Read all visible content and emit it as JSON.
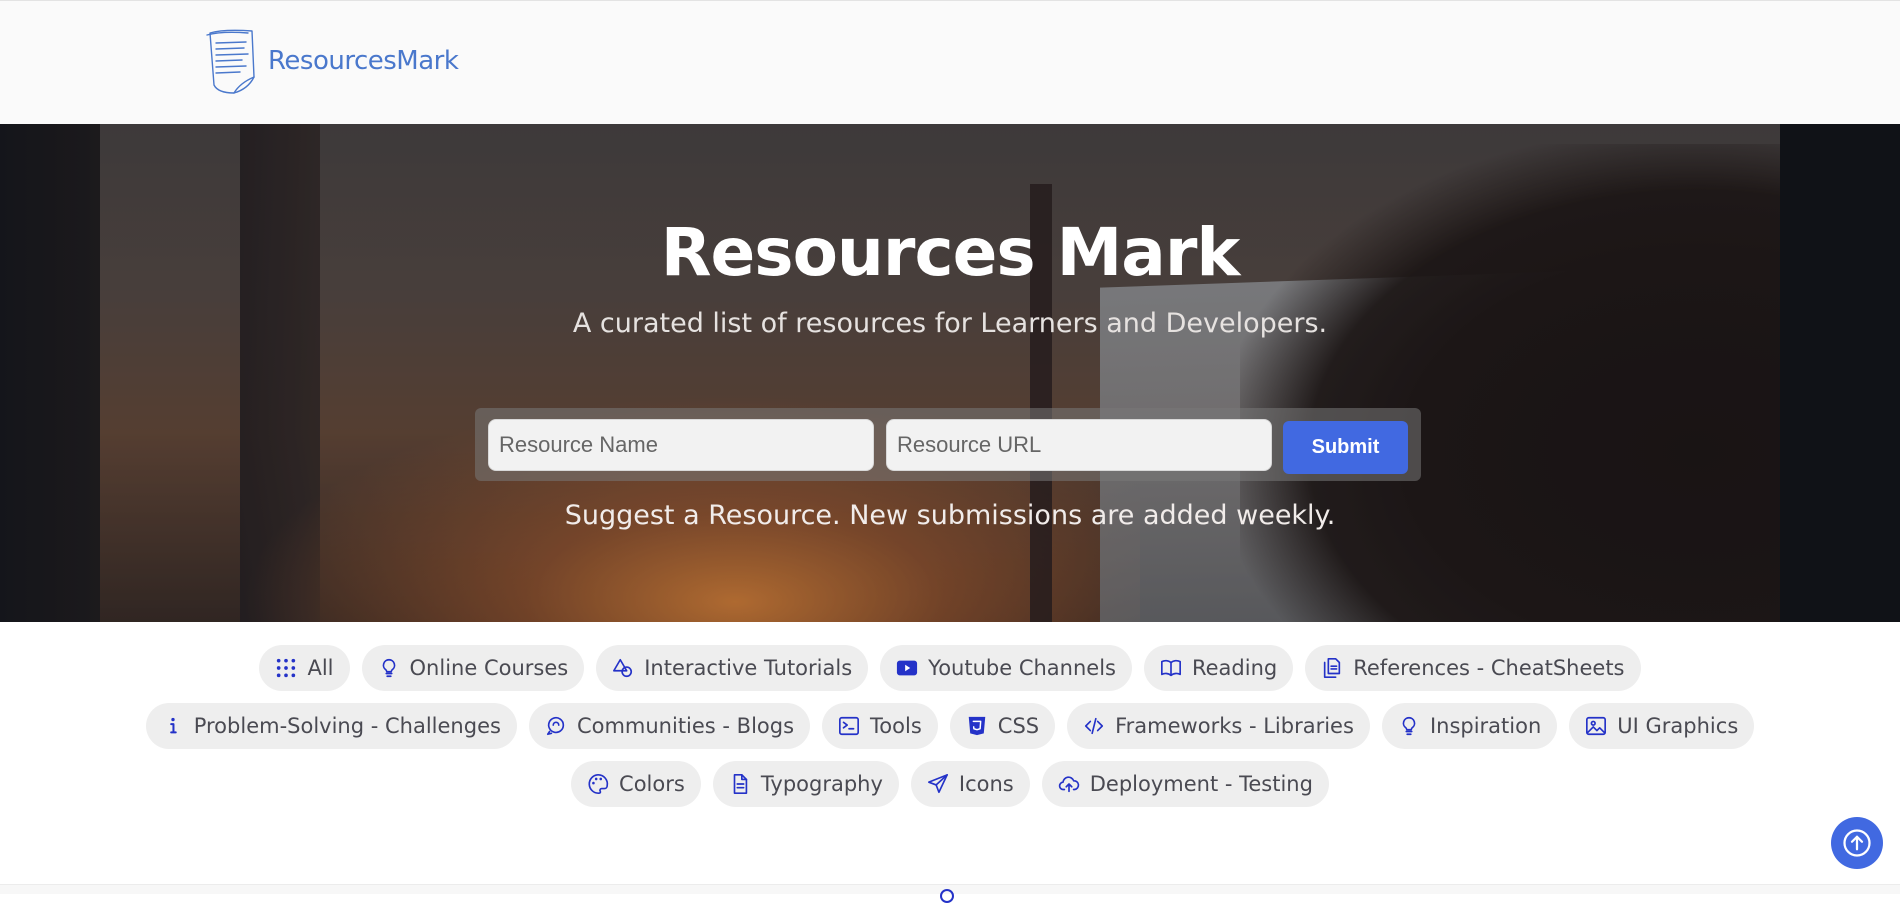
{
  "navbar": {
    "brand": "ResourcesMark",
    "logo_icon": "notepad-icon"
  },
  "hero": {
    "title": "Resources Mark",
    "subtitle": "A curated list of resources for Learners and Developers.",
    "form": {
      "name_placeholder": "Resource Name",
      "name_value": "",
      "url_placeholder": "Resource URL",
      "url_value": "",
      "submit_label": "Submit"
    },
    "note": "Suggest a Resource. New submissions are added weekly."
  },
  "filters": [
    {
      "label": "All",
      "icon": "grid-icon"
    },
    {
      "label": "Online Courses",
      "icon": "lightbulb-icon"
    },
    {
      "label": "Interactive Tutorials",
      "icon": "shapes-icon"
    },
    {
      "label": "Youtube Channels",
      "icon": "youtube-icon"
    },
    {
      "label": "Reading",
      "icon": "book-icon"
    },
    {
      "label": "References - CheatSheets",
      "icon": "files-icon"
    },
    {
      "label": "Problem-Solving - Challenges",
      "icon": "info-icon"
    },
    {
      "label": "Communities - Blogs",
      "icon": "chat-icon"
    },
    {
      "label": "Tools",
      "icon": "terminal-icon"
    },
    {
      "label": "CSS",
      "icon": "css-icon"
    },
    {
      "label": "Frameworks - Libraries",
      "icon": "code-icon"
    },
    {
      "label": "Inspiration",
      "icon": "lightbulb-icon"
    },
    {
      "label": "UI Graphics",
      "icon": "image-icon"
    },
    {
      "label": "Colors",
      "icon": "palette-icon"
    },
    {
      "label": "Typography",
      "icon": "document-icon"
    },
    {
      "label": "Icons",
      "icon": "send-icon"
    },
    {
      "label": "Deployment - Testing",
      "icon": "cloud-upload-icon"
    }
  ],
  "scroll_top": {
    "icon": "arrow-up-circle-icon"
  },
  "colors": {
    "accent": "#4169e1",
    "icon": "#2432c8",
    "brand": "#4a78cc"
  }
}
